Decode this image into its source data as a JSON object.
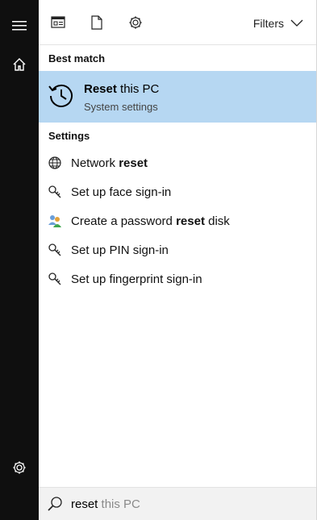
{
  "rail": {
    "icons": [
      "hamburger-menu-icon",
      "home-icon",
      "gear-icon"
    ]
  },
  "topbar": {
    "icons": [
      "apps-icon",
      "documents-icon",
      "settings-icon"
    ],
    "filters_label": "Filters"
  },
  "best_match": {
    "section_label": "Best match",
    "title_bold": "Reset",
    "title_rest": " this PC",
    "subtitle": "System settings"
  },
  "settings": {
    "section_label": "Settings",
    "items": [
      {
        "pre": "Network ",
        "bold": "reset",
        "post": "",
        "icon": "network-globe-icon"
      },
      {
        "pre": "Set up face sign-in",
        "bold": "",
        "post": "",
        "icon": "key-icon"
      },
      {
        "pre": "Create a password ",
        "bold": "reset",
        "post": " disk",
        "icon": "users-icon"
      },
      {
        "pre": "Set up PIN sign-in",
        "bold": "",
        "post": "",
        "icon": "key-icon"
      },
      {
        "pre": "Set up fingerprint sign-in",
        "bold": "",
        "post": "",
        "icon": "key-icon"
      }
    ]
  },
  "search": {
    "typed": "reset",
    "suggestion": " this PC"
  },
  "colors": {
    "rail_bg": "#0f0f0f",
    "highlight": "#b6d7f2",
    "search_bg": "#f2f2f2"
  }
}
